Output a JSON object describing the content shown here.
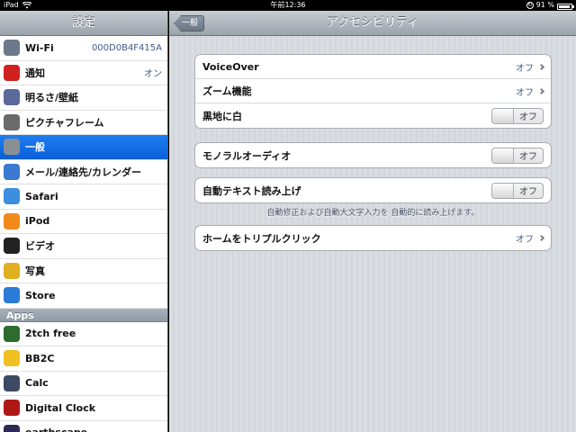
{
  "statusbar": {
    "device": "iPad",
    "time": "午前12:36",
    "battery_pct": "91 %",
    "battery_level": 0.91
  },
  "sidebar": {
    "title": "設定",
    "items": [
      {
        "label": "Wi-Fi",
        "value": "000D0B4F415A",
        "icon": "wifi-icon",
        "color": "#6b7a8a"
      },
      {
        "label": "通知",
        "value": "オン",
        "icon": "notification-icon",
        "color": "#d02020"
      },
      {
        "label": "明るさ/壁紙",
        "value": "",
        "icon": "brightness-icon",
        "color": "#5a6a9a"
      },
      {
        "label": "ピクチャフレーム",
        "value": "",
        "icon": "picture-frame-icon",
        "color": "#6b6b6b"
      },
      {
        "label": "一般",
        "value": "",
        "icon": "gear-icon",
        "color": "#8a8f96"
      },
      {
        "label": "メール/連絡先/カレンダー",
        "value": "",
        "icon": "mail-icon",
        "color": "#3b7ad0"
      },
      {
        "label": "Safari",
        "value": "",
        "icon": "safari-icon",
        "color": "#3d8ee0"
      },
      {
        "label": "iPod",
        "value": "",
        "icon": "ipod-icon",
        "color": "#f08a1a"
      },
      {
        "label": "ビデオ",
        "value": "",
        "icon": "video-icon",
        "color": "#222222"
      },
      {
        "label": "写真",
        "value": "",
        "icon": "photos-icon",
        "color": "#e0b020"
      },
      {
        "label": "Store",
        "value": "",
        "icon": "store-icon",
        "color": "#2a7ad8"
      }
    ],
    "apps_header": "Apps",
    "apps": [
      {
        "label": "2tch free",
        "icon": "2tch-icon",
        "color": "#2e6b2e"
      },
      {
        "label": "BB2C",
        "icon": "bb2c-icon",
        "color": "#f0c020"
      },
      {
        "label": "Calc",
        "icon": "calc-icon",
        "color": "#3c4a66"
      },
      {
        "label": "Digital Clock",
        "icon": "clock-icon",
        "color": "#b01818"
      },
      {
        "label": "earthscape",
        "icon": "earth-icon",
        "color": "#2a2a55"
      }
    ]
  },
  "nav": {
    "back_label": "一般",
    "title": "アクセシビリティ"
  },
  "group1": {
    "voiceover_label": "VoiceOver",
    "voiceover_value": "オフ",
    "zoom_label": "ズーム機能",
    "zoom_value": "オフ",
    "white_on_black_label": "黒地に白",
    "white_on_black_switch": "オフ"
  },
  "group2": {
    "mono_audio_label": "モノラルオーディオ",
    "mono_audio_switch": "オフ"
  },
  "group3": {
    "speak_text_label": "自動テキスト読み上げ",
    "speak_text_switch": "オフ",
    "footnote": "自動修正および自動大文字入力を 自動的に読み上げます。"
  },
  "group4": {
    "triple_click_label": "ホームをトリプルクリック",
    "triple_click_value": "オフ"
  }
}
